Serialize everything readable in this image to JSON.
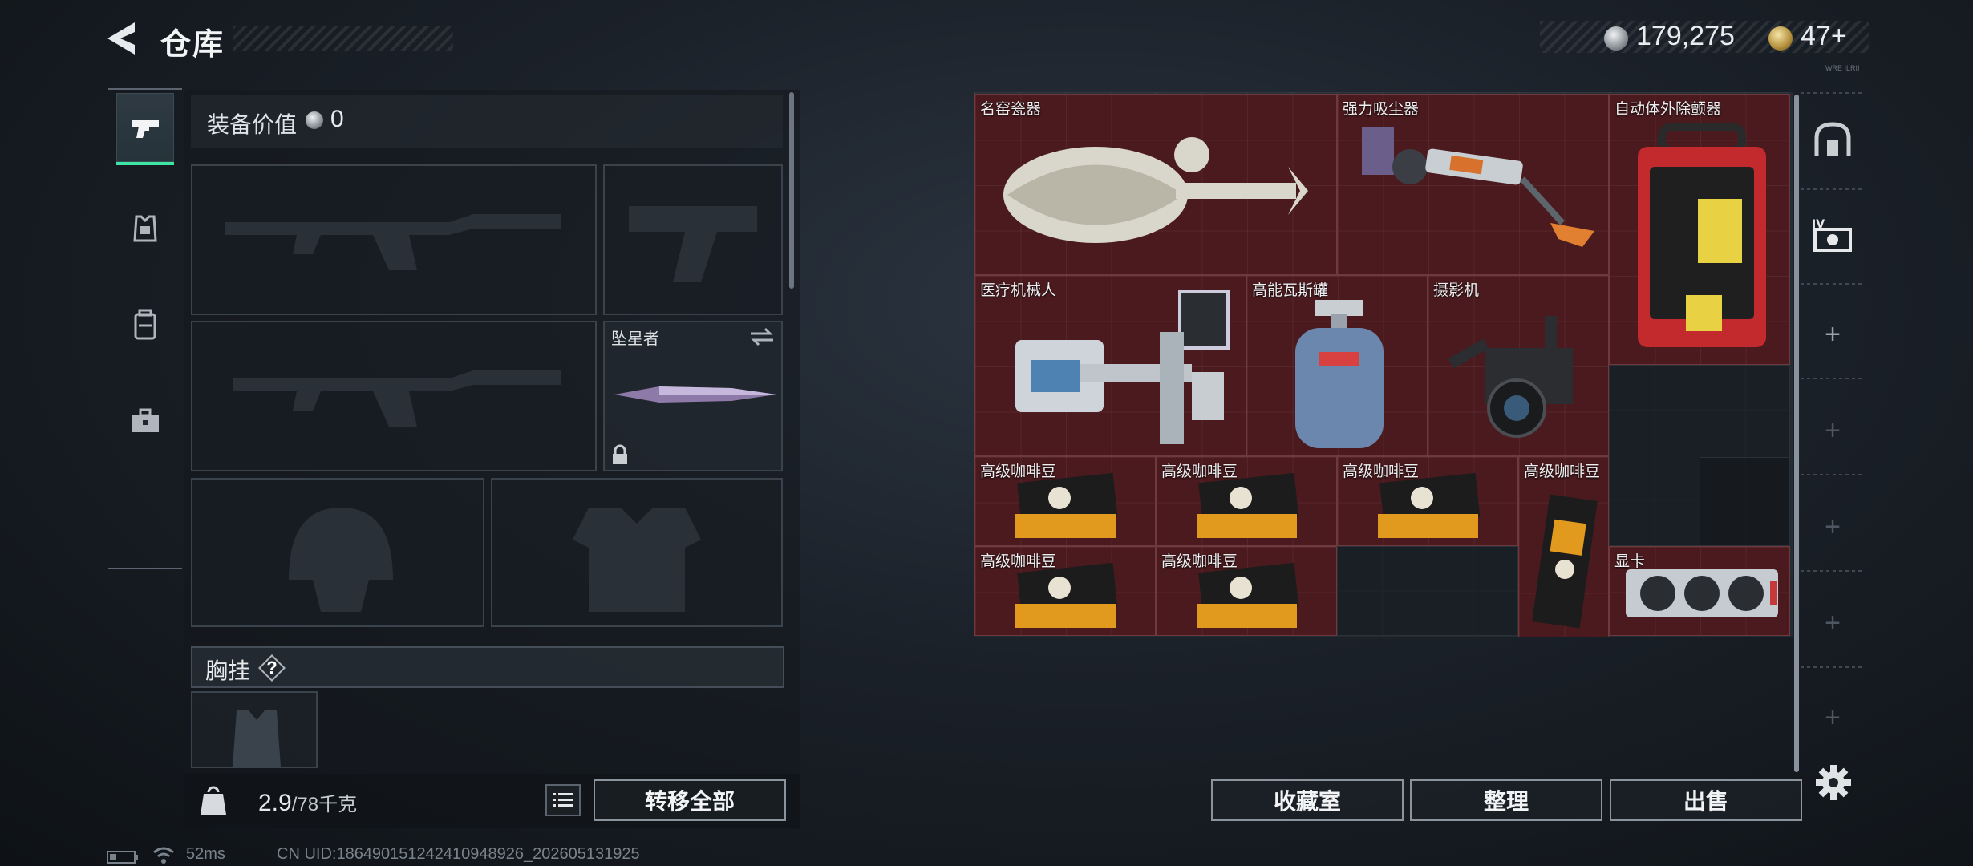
{
  "header": {
    "title": "仓库",
    "money": "179,275",
    "premium": "47+",
    "tiny_code": "WRE ILRII"
  },
  "category_tabs": [
    {
      "name": "weapons",
      "icon": "pistol-icon",
      "active": true
    },
    {
      "name": "armor",
      "icon": "armor-icon",
      "active": false
    },
    {
      "name": "backpack",
      "icon": "backpack-icon",
      "active": false
    },
    {
      "name": "toolbox",
      "icon": "toolbox-icon",
      "active": false
    }
  ],
  "loadout": {
    "value_label": "装备价值",
    "value": "0",
    "melee_slot_title": "坠星者",
    "chest_rig_label": "胸挂",
    "help_label": "?",
    "weight": "2.9",
    "weight_max": "/78千克",
    "transfer_all_label": "转移全部"
  },
  "stash_items": [
    {
      "id": "vase",
      "name": "名窑瓷器"
    },
    {
      "id": "vacuum",
      "name": "强力吸尘器"
    },
    {
      "id": "aed",
      "name": "自动体外除颤器"
    },
    {
      "id": "med-robot",
      "name": "医疗机械人"
    },
    {
      "id": "gas-tank",
      "name": "高能瓦斯罐"
    },
    {
      "id": "camera",
      "name": "摄影机"
    },
    {
      "id": "coffee-1",
      "name": "高级咖啡豆"
    },
    {
      "id": "coffee-2",
      "name": "高级咖啡豆"
    },
    {
      "id": "coffee-3",
      "name": "高级咖啡豆"
    },
    {
      "id": "coffee-4",
      "name": "高级咖啡豆"
    },
    {
      "id": "coffee-5",
      "name": "高级咖啡豆"
    },
    {
      "id": "coffee-6",
      "name": "高级咖啡豆"
    },
    {
      "id": "gpu",
      "name": "显卡"
    }
  ],
  "actions": {
    "collection_label": "收藏室",
    "sort_label": "整理",
    "sell_label": "出售"
  },
  "side_tabs": {
    "plus": "+"
  },
  "status": {
    "ping": "52ms",
    "uid": "CN UID:1864901512424109489​26_202605131925"
  },
  "colors": {
    "item_bg": "#4a1a1e",
    "accent": "#3ee6a6"
  }
}
